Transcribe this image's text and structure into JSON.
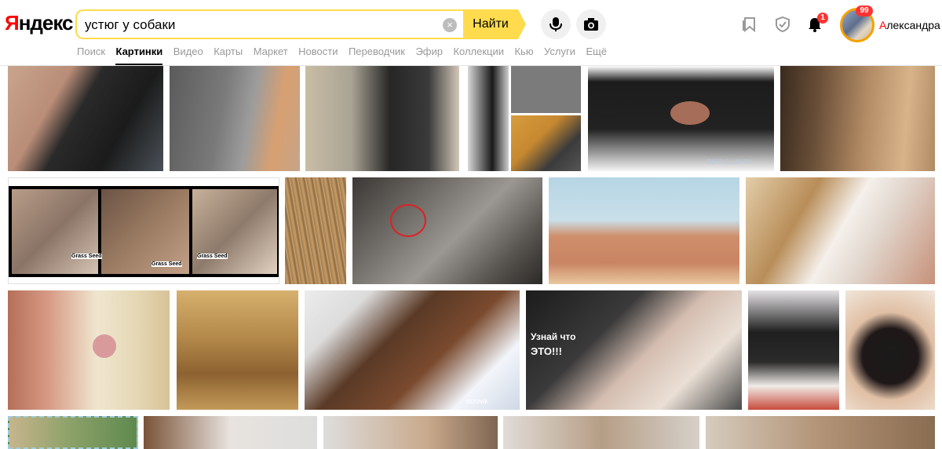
{
  "logo": {
    "first_letter": "Я",
    "rest": "ндекс"
  },
  "search": {
    "query": "устюг у собаки",
    "button_label": "Найти",
    "clear_glyph": "×"
  },
  "tabs": [
    {
      "label": "Поиск"
    },
    {
      "label": "Картинки"
    },
    {
      "label": "Видео"
    },
    {
      "label": "Карты"
    },
    {
      "label": "Маркет"
    },
    {
      "label": "Новости"
    },
    {
      "label": "Переводчик"
    },
    {
      "label": "Эфир"
    },
    {
      "label": "Коллекции"
    },
    {
      "label": "Кью"
    },
    {
      "label": "Услуги"
    },
    {
      "label": "Ещё"
    }
  ],
  "active_tab": "Картинки",
  "user": {
    "name_first": "А",
    "name_rest": "лександра",
    "notification_count": "1",
    "mail_count": "99"
  },
  "icons": [
    "microphone-icon",
    "camera-icon",
    "collections-icon",
    "shield-icon",
    "bell-icon"
  ],
  "image_labels": {
    "grass_seed_1": "Grass Seed",
    "grass_seed_2": "Grass Seed",
    "grass_seed_3": "Grass Seed",
    "watermark_bern": "BERNCLUB.RU",
    "watermark_otzovik": "otzovik",
    "caption_line1": "Узнай что",
    "caption_line2": "ЭТО!!!"
  },
  "colors": {
    "accent": "#ffdb4d",
    "brand_red": "#ff0000",
    "badge": "#ff3333"
  }
}
